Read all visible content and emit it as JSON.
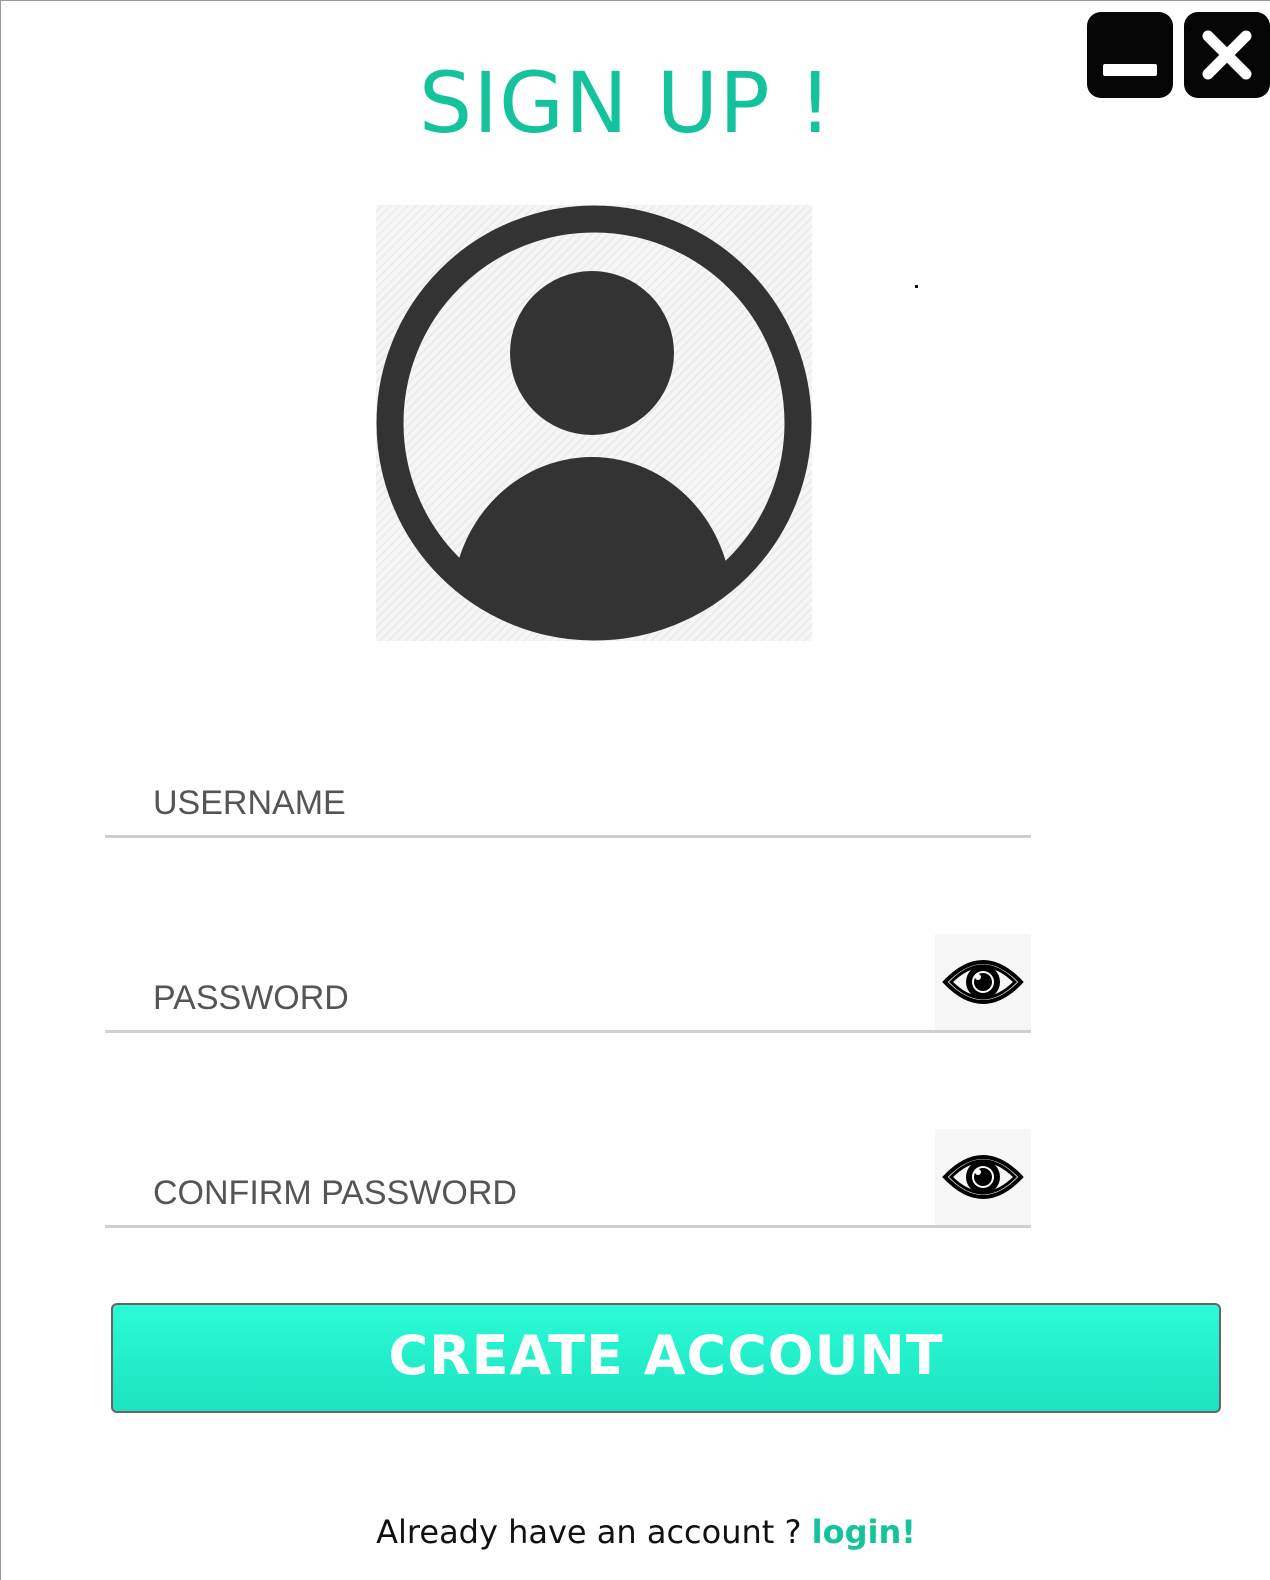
{
  "window": {
    "minimize_icon": "minimize-icon",
    "close_icon": "close-icon"
  },
  "header": {
    "title": "SIGN UP !"
  },
  "avatar": {
    "icon": "user-avatar-icon"
  },
  "form": {
    "username_placeholder": "USERNAME",
    "username_value": "",
    "password_placeholder": "PASSWORD",
    "password_value": "",
    "confirm_placeholder": "CONFIRM PASSWORD",
    "confirm_value": "",
    "show_password_icon": "eye-icon"
  },
  "actions": {
    "create_label": "CREATE ACCOUNT"
  },
  "footer": {
    "prompt": "Already have an account ?",
    "login_label": "login!"
  },
  "colors": {
    "accent": "#14c39c",
    "button_top": "#2afbd6",
    "button_bottom": "#1de3bf",
    "icon_dark": "#333333"
  }
}
